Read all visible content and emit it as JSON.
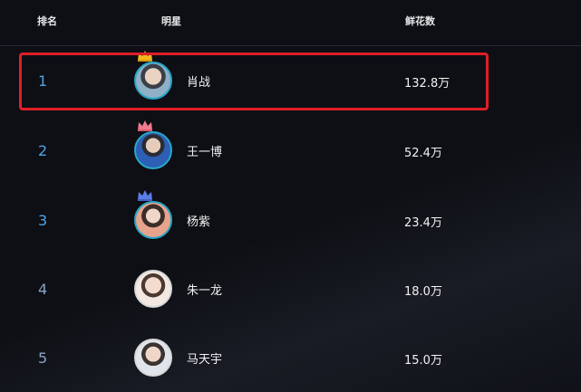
{
  "header": {
    "rank_label": "排名",
    "star_label": "明星",
    "flowers_label": "鲜花数"
  },
  "rows": [
    {
      "rank": "1",
      "name": "肖战",
      "flowers": "132.8万",
      "crown": "gold-crown-icon"
    },
    {
      "rank": "2",
      "name": "王一博",
      "flowers": "52.4万",
      "crown": "pink-crown-icon"
    },
    {
      "rank": "3",
      "name": "杨紫",
      "flowers": "23.4万",
      "crown": "blue-crown-icon"
    },
    {
      "rank": "4",
      "name": "朱一龙",
      "flowers": "18.0万"
    },
    {
      "rank": "5",
      "name": "马天宇",
      "flowers": "15.0万"
    }
  ],
  "colors": {
    "background": "#0d0f14",
    "rank_top3": "#4ea3e6",
    "rank_other": "#8aa4c4",
    "highlight_border": "#e01e26",
    "avatar_ring_top3": "#28a7c8"
  }
}
